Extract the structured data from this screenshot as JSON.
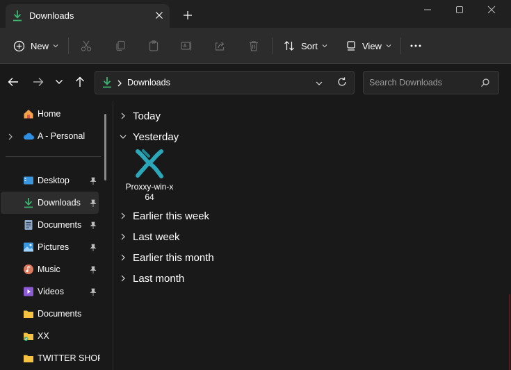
{
  "window": {
    "tab_title": "Downloads",
    "colors": {
      "accent_green": "#3bb371",
      "background": "#191919",
      "toolbar": "#2c2c2c"
    }
  },
  "toolbar": {
    "new_label": "New",
    "sort_label": "Sort",
    "view_label": "View",
    "icons": [
      "cut-icon",
      "copy-icon",
      "paste-icon",
      "rename-icon",
      "share-icon",
      "delete-icon",
      "more-icon"
    ]
  },
  "address": {
    "crumb": "Downloads"
  },
  "search": {
    "placeholder": "Search Downloads"
  },
  "sidebar": {
    "items": [
      {
        "label": "Home",
        "icon": "home-icon"
      },
      {
        "label": "A - Personal",
        "icon": "cloud-icon"
      },
      {
        "label": "Desktop",
        "icon": "desktop-icon",
        "pinned": true
      },
      {
        "label": "Downloads",
        "icon": "download-icon",
        "pinned": true,
        "active": true
      },
      {
        "label": "Documents",
        "icon": "document-icon",
        "pinned": true
      },
      {
        "label": "Pictures",
        "icon": "pictures-icon",
        "pinned": true
      },
      {
        "label": "Music",
        "icon": "music-icon",
        "pinned": true
      },
      {
        "label": "Videos",
        "icon": "videos-icon",
        "pinned": true
      },
      {
        "label": "Documents",
        "icon": "folder-icon"
      },
      {
        "label": "XX",
        "icon": "folder-icon"
      },
      {
        "label": "TWITTER SHORT C",
        "icon": "folder-icon"
      }
    ]
  },
  "content": {
    "groups": [
      {
        "label": "Today",
        "expanded": false
      },
      {
        "label": "Yesterday",
        "expanded": true
      },
      {
        "label": "Earlier this week",
        "expanded": false
      },
      {
        "label": "Last week",
        "expanded": false
      },
      {
        "label": "Earlier this month",
        "expanded": false
      },
      {
        "label": "Last month",
        "expanded": false
      }
    ],
    "files": [
      {
        "name": "Proxxy-win-x64",
        "icon": "proxxy-app-icon"
      }
    ]
  }
}
